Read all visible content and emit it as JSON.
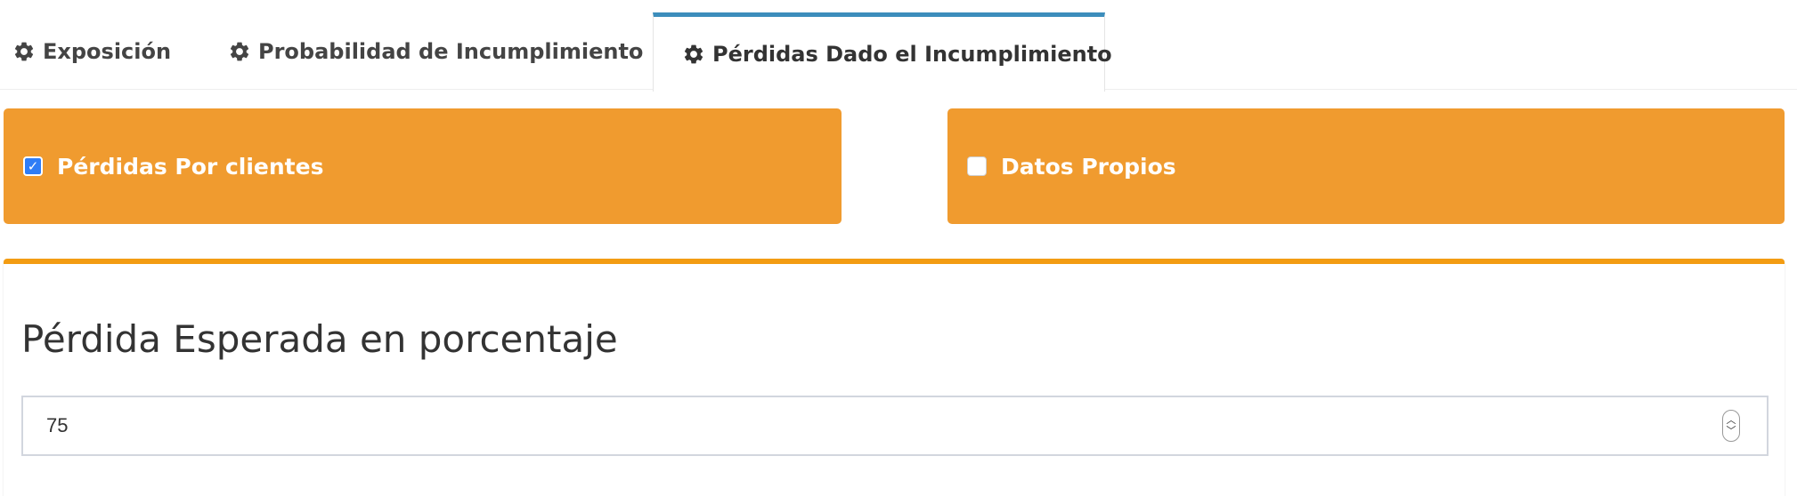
{
  "tabs": [
    {
      "label": "Exposición",
      "icon": "gear-icon",
      "active": false
    },
    {
      "label": "Probabilidad de Incumplimiento",
      "icon": "gear-icon",
      "active": false
    },
    {
      "label": "Pérdidas Dado el Incumplimiento",
      "icon": "gear-icon",
      "active": true
    }
  ],
  "options": {
    "left": {
      "label": "Pérdidas Por clientes",
      "checked": true
    },
    "right": {
      "label": "Datos Propios",
      "checked": false
    }
  },
  "panel": {
    "title": "Pérdida Esperada en porcentaje",
    "input_value": "75"
  },
  "colors": {
    "active_tab_border": "#3c8dbc",
    "orange_box": "#f09b2f",
    "panel_border": "#f39c12",
    "checkbox_checked": "#2f7df6"
  }
}
